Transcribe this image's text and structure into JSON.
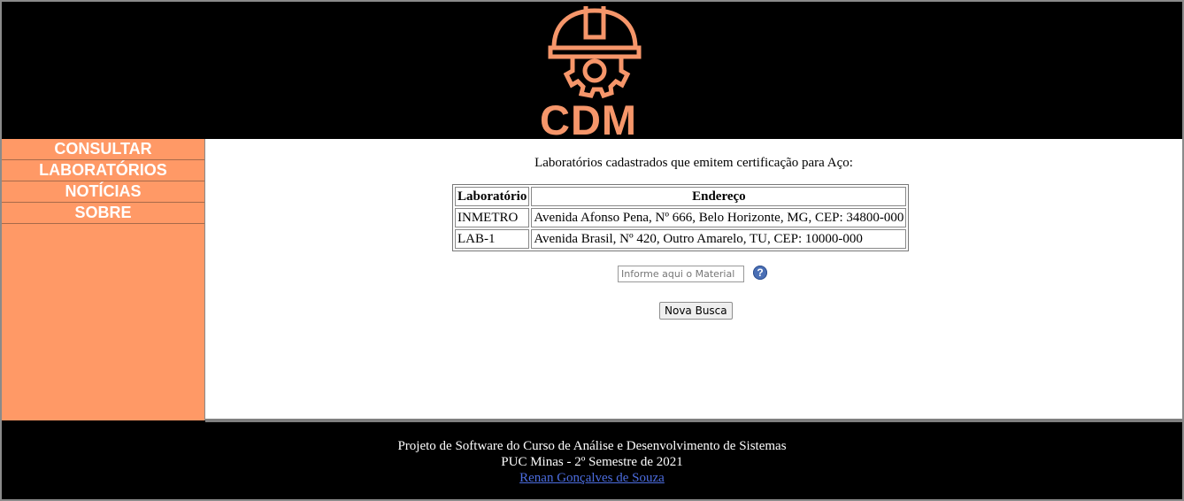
{
  "brand": {
    "logo_text": "CDM",
    "color": "#f6966a"
  },
  "nav": {
    "items": [
      {
        "label": "CONSULTAR"
      },
      {
        "label": "LABORATÓRIOS"
      },
      {
        "label": "NOTÍCIAS"
      },
      {
        "label": "SOBRE"
      }
    ]
  },
  "main": {
    "heading": "Laboratórios cadastrados que emitem certificação para Aço:",
    "table": {
      "headers": [
        "Laboratório",
        "Endereço"
      ],
      "rows": [
        [
          "INMETRO",
          "Avenida Afonso Pena, Nº 666, Belo Horizonte, MG, CEP: 34800-000"
        ],
        [
          "LAB-1",
          "Avenida Brasil, Nº 420, Outro Amarelo, TU, CEP: 10000-000"
        ]
      ]
    },
    "search": {
      "placeholder": "Informe aqui o Material",
      "value": ""
    },
    "help_icon": "question-circle-icon",
    "help_glyph": "?",
    "button_label": "Nova Busca"
  },
  "footer": {
    "line1": "Projeto de Software do Curso de Análise e Desenvolvimento de Sistemas",
    "line2": "PUC Minas - 2º Semestre de 2021",
    "author_link": "Renan Gonçalves de Souza"
  }
}
